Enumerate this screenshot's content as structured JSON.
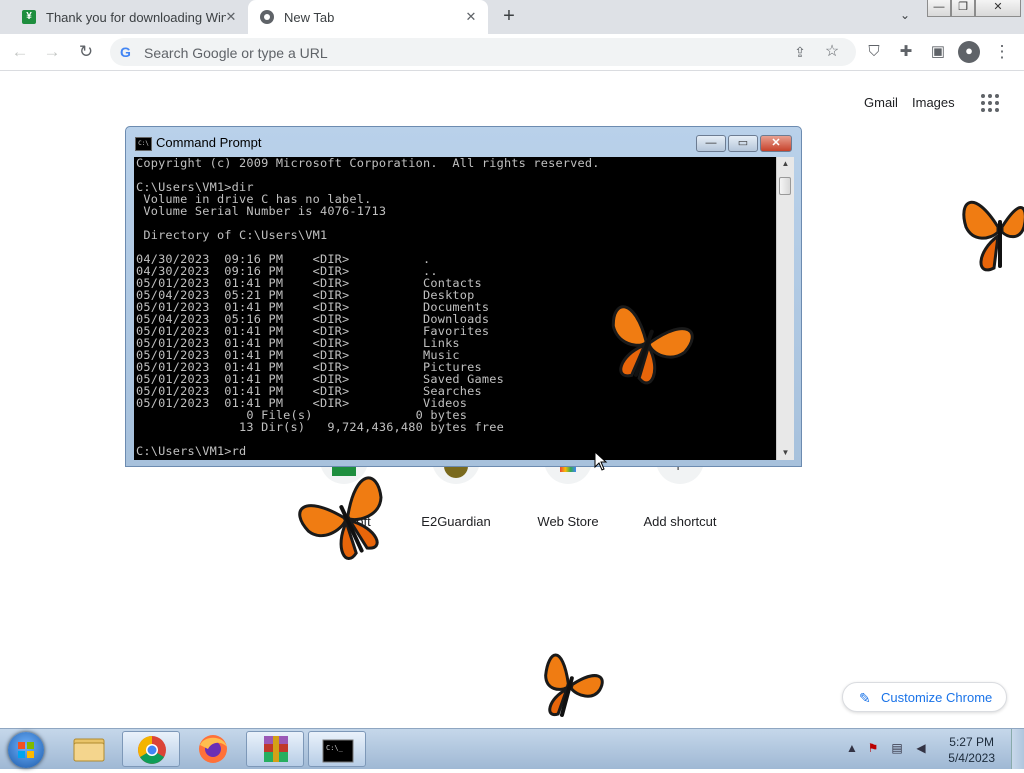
{
  "browser": {
    "tabs": [
      {
        "title": "Thank you for downloading WinF",
        "favicon": "download-site-icon",
        "active": false
      },
      {
        "title": "New Tab",
        "favicon": "chrome-icon",
        "active": true
      }
    ],
    "omnibox_placeholder": "Search Google or type a URL"
  },
  "newtab": {
    "gmail": "Gmail",
    "images": "Images",
    "shortcuts": [
      {
        "label": "Free Soft"
      },
      {
        "label": "E2Guardian"
      },
      {
        "label": "Web Store"
      },
      {
        "label": "Add shortcut"
      }
    ],
    "customize": "Customize Chrome"
  },
  "cmd": {
    "title": "Command Prompt",
    "lines": [
      "Copyright (c) 2009 Microsoft Corporation.  All rights reserved.",
      "",
      "C:\\Users\\VM1>dir",
      " Volume in drive C has no label.",
      " Volume Serial Number is 4076-1713",
      "",
      " Directory of C:\\Users\\VM1",
      "",
      "04/30/2023  09:16 PM    <DIR>          .",
      "04/30/2023  09:16 PM    <DIR>          ..",
      "05/01/2023  01:41 PM    <DIR>          Contacts",
      "05/04/2023  05:21 PM    <DIR>          Desktop",
      "05/01/2023  01:41 PM    <DIR>          Documents",
      "05/04/2023  05:16 PM    <DIR>          Downloads",
      "05/01/2023  01:41 PM    <DIR>          Favorites",
      "05/01/2023  01:41 PM    <DIR>          Links",
      "05/01/2023  01:41 PM    <DIR>          Music",
      "05/01/2023  01:41 PM    <DIR>          Pictures",
      "05/01/2023  01:41 PM    <DIR>          Saved Games",
      "05/01/2023  01:41 PM    <DIR>          Searches",
      "05/01/2023  01:41 PM    <DIR>          Videos",
      "               0 File(s)              0 bytes",
      "              13 Dir(s)   9,724,436,480 bytes free",
      "",
      "C:\\Users\\VM1>rd"
    ]
  },
  "taskbar": {
    "time": "5:27 PM",
    "date": "5/4/2023",
    "pinned": [
      "explorer-icon",
      "chrome-icon",
      "firefox-icon",
      "winrar-icon",
      "cmd-icon"
    ]
  },
  "colors": {
    "butterfly": "#f07c12",
    "console_bg": "#000000",
    "console_fg": "#c0c0c0",
    "link": "#1a73e8"
  }
}
